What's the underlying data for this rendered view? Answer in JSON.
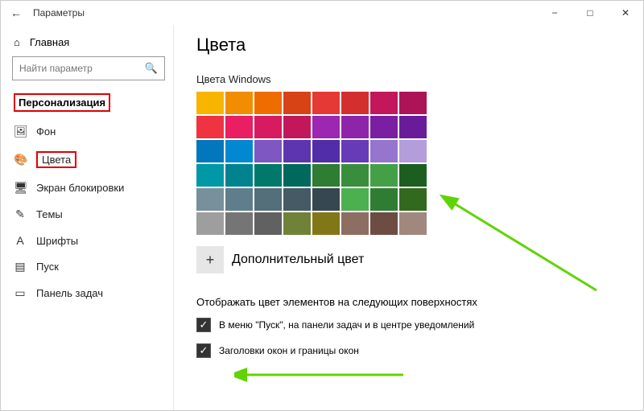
{
  "window": {
    "title": "Параметры"
  },
  "sidebar": {
    "home": "Главная",
    "search_placeholder": "Найти параметр",
    "section": "Персонализация",
    "items": [
      {
        "icon": "🖼",
        "label": "Фон"
      },
      {
        "icon": "🎨",
        "label": "Цвета",
        "selected": true
      },
      {
        "icon": "🖥",
        "label": "Экран блокировки"
      },
      {
        "icon": "✎",
        "label": "Темы"
      },
      {
        "icon": "A",
        "label": "Шрифты"
      },
      {
        "icon": "▤",
        "label": "Пуск"
      },
      {
        "icon": "▭",
        "label": "Панель задач"
      }
    ]
  },
  "main": {
    "title": "Цвета",
    "palette_heading": "Цвета Windows",
    "colors": [
      "#f7b500",
      "#f28c00",
      "#ef6c00",
      "#d84315",
      "#e53935",
      "#d32f2f",
      "#c2185b",
      "#ad1457",
      "#ef3340",
      "#e91e63",
      "#d81b60",
      "#c2185b",
      "#9c27b0",
      "#8e24aa",
      "#7b1fa2",
      "#6a1b9a",
      "#0277bd",
      "#0288d1",
      "#7e57c2",
      "#5e35b1",
      "#512da8",
      "#673ab7",
      "#9575cd",
      "#b39ddb",
      "#0097a7",
      "#00838f",
      "#00796b",
      "#00695c",
      "#2e7d32",
      "#388e3c",
      "#43a047",
      "#1b5e20",
      "#78909c",
      "#607d8b",
      "#546e7a",
      "#455a64",
      "#37474f",
      "#4caf50",
      "#2e7d32",
      "#33691e",
      "#9e9e9e",
      "#757575",
      "#616161",
      "#708238",
      "#827717",
      "#8d6e63",
      "#6d4c41",
      "#a1887f"
    ],
    "add_color_label": "Дополнительный цвет",
    "surfaces_heading": "Отображать цвет элементов на следующих поверхностях",
    "checks": [
      {
        "checked": true,
        "label": "В меню \"Пуск\", на панели задач и в центре уведомлений"
      },
      {
        "checked": true,
        "label": "Заголовки окон и границы окон"
      }
    ]
  }
}
